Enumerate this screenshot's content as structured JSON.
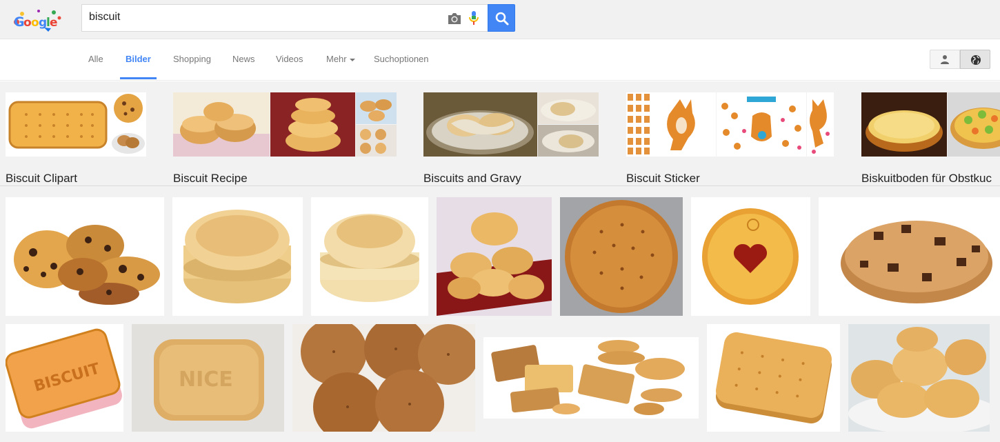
{
  "search": {
    "query": "biscuit"
  },
  "icons": {
    "logo": "google-doodle-logo",
    "camera": "camera-icon",
    "mic": "microphone-icon",
    "search": "search-icon",
    "person": "person-icon",
    "globe": "globe-icon"
  },
  "colors": {
    "accent": "#4285f4",
    "header_bg": "#f1f1f1",
    "strip_bg": "#f2f2f2"
  },
  "nav": {
    "tabs": [
      {
        "label": "Alle"
      },
      {
        "label": "Bilder"
      },
      {
        "label": "Shopping"
      },
      {
        "label": "News"
      },
      {
        "label": "Videos"
      },
      {
        "label": "Mehr"
      },
      {
        "label": "Suchoptionen"
      }
    ],
    "active_tab": "Bilder"
  },
  "related": [
    {
      "label": "Biscuit Clipart"
    },
    {
      "label": "Biscuit Recipe"
    },
    {
      "label": "Biscuits and Gravy"
    },
    {
      "label": "Biscuit Sticker"
    },
    {
      "label": "Biskuitboden für Obstkuc"
    }
  ]
}
